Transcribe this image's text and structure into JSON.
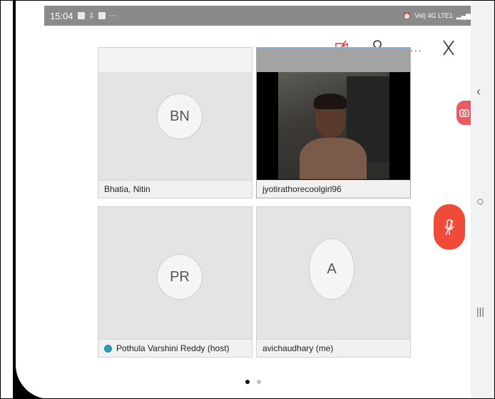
{
  "status_bar": {
    "time": "15:04",
    "more": "···",
    "network": "Vol) 4G LTE1"
  },
  "toolbar": {
    "more": "···",
    "camera_icon": "camera-off-icon",
    "participants_icon": "participants-icon",
    "close_icon": "close-icon",
    "accent": "#e8453c"
  },
  "tiles": [
    {
      "initials": "BN",
      "name": "Bhatia, Nitin"
    },
    {
      "name": "jyotirathorecoolgirl96",
      "video": true
    },
    {
      "initials": "PR",
      "name": "Pothula Varshini Reddy (host)"
    },
    {
      "initials": "A",
      "name": "avichaudhary (me)"
    }
  ],
  "page_indicator": {
    "count": 2,
    "active": 0
  },
  "side_controls": {
    "video_button_icon": "camera-icon",
    "mute_button_icon": "mic-off-icon",
    "mute_color": "#f04a38"
  },
  "nav_buttons": {
    "back": "‹",
    "home": "○",
    "recents": "|||"
  }
}
